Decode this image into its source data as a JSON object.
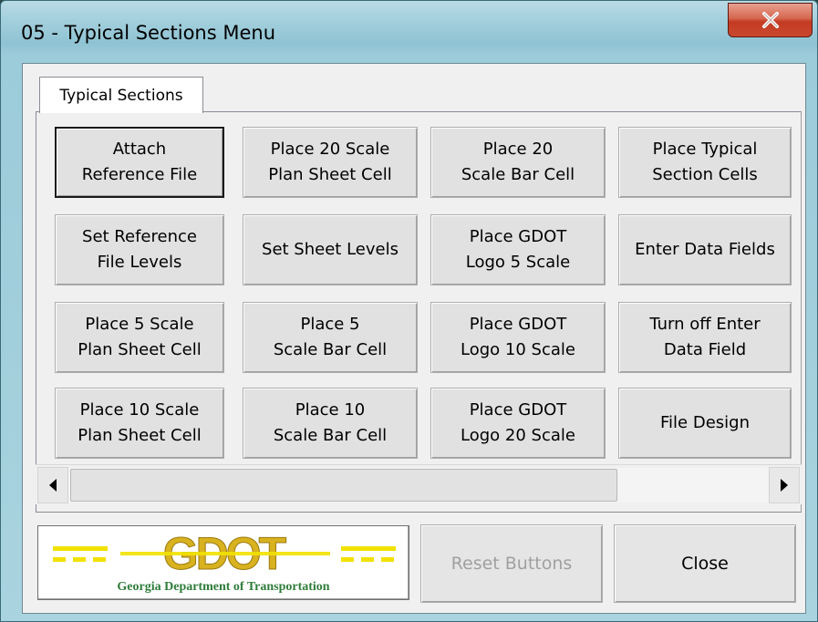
{
  "window": {
    "title": "05 - Typical Sections Menu",
    "close_glyph": "X"
  },
  "tabs": [
    {
      "label": "Typical Sections",
      "selected": true
    }
  ],
  "buttons": [
    {
      "label": "Attach\nReference File",
      "default": true
    },
    {
      "label": "Place 20 Scale\nPlan Sheet Cell"
    },
    {
      "label": "Place 20\nScale Bar Cell"
    },
    {
      "label": "Place Typical\nSection Cells"
    },
    {
      "label": "Set Reference\nFile Levels"
    },
    {
      "label": "Set Sheet Levels"
    },
    {
      "label": "Place GDOT\nLogo 5 Scale"
    },
    {
      "label": "Enter Data Fields"
    },
    {
      "label": "Place 5 Scale\nPlan Sheet Cell"
    },
    {
      "label": "Place 5\nScale Bar Cell"
    },
    {
      "label": "Place GDOT\nLogo 10 Scale"
    },
    {
      "label": "Turn off Enter\nData Field"
    },
    {
      "label": "Place 10 Scale\nPlan Sheet Cell"
    },
    {
      "label": "Place 10\nScale Bar Cell"
    },
    {
      "label": "Place GDOT\nLogo 20 Scale"
    },
    {
      "label": "File Design"
    }
  ],
  "scrollbar": {
    "left_arrow": "◀",
    "right_arrow": "▶"
  },
  "logo": {
    "wordmark": "GDOT",
    "caption": "Georgia Department of Transportation",
    "colors": {
      "gold": "#d8b21f",
      "green": "#2e7d3a",
      "yellow": "#f2e200"
    }
  },
  "footer": {
    "reset_label": "Reset Buttons",
    "close_label": "Close"
  },
  "colors": {
    "title_gradient_top": "#b9dbe6",
    "close_red": "#c43b22",
    "panel_bg": "#f0f0f0"
  }
}
